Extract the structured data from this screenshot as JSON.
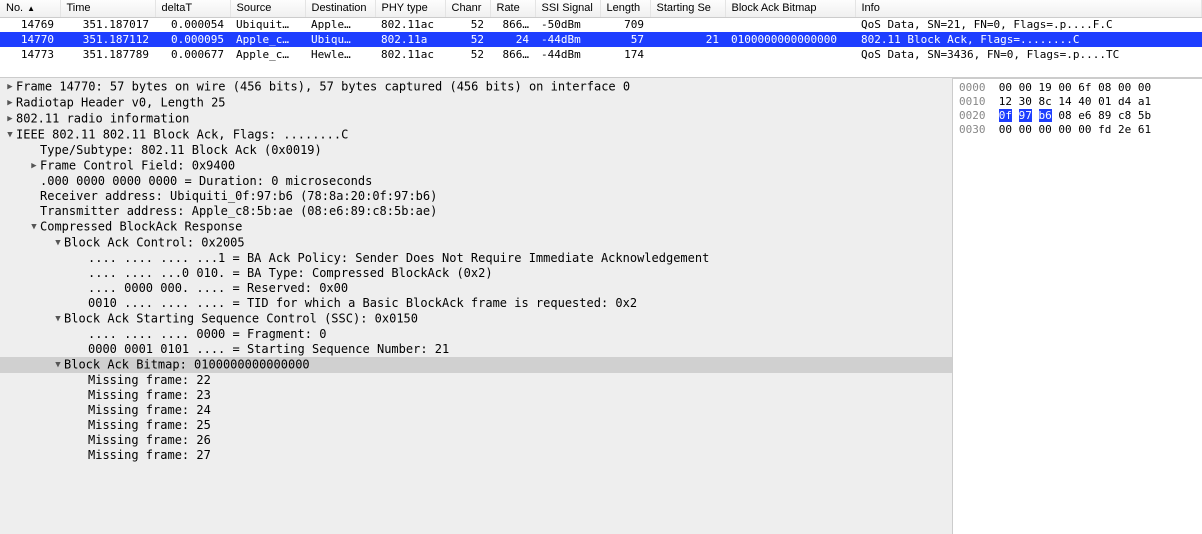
{
  "packet_list": {
    "columns": [
      "No.",
      "Time",
      "deltaT",
      "Source",
      "Destination",
      "PHY type",
      "Chanr",
      "Rate",
      "SSI Signal",
      "Length",
      "Starting Se",
      "Block Ack Bitmap",
      "Info"
    ],
    "sort_col_idx": 0,
    "rows": [
      {
        "cells": [
          "14769",
          "351.187017",
          "0.000054",
          "Ubiquit…",
          "Apple…",
          "802.11ac",
          "52",
          "866…",
          "-50dBm",
          "709",
          "",
          "",
          "QoS Data, SN=21, FN=0, Flags=.p....F.C"
        ],
        "selected": false
      },
      {
        "cells": [
          "14770",
          "351.187112",
          "0.000095",
          "Apple_c…",
          "Ubiqu…",
          "802.11a",
          "52",
          "24",
          "-44dBm",
          "57",
          "21",
          "0100000000000000",
          "802.11 Block Ack, Flags=........C"
        ],
        "selected": true
      },
      {
        "cells": [
          "14773",
          "351.187789",
          "0.000677",
          "Apple_c…",
          "Hewle…",
          "802.11ac",
          "52",
          "866…",
          "-44dBm",
          "174",
          "",
          "",
          "QoS Data, SN=3436, FN=0, Flags=.p....TC"
        ],
        "selected": false
      }
    ]
  },
  "tree": [
    {
      "depth": 0,
      "tri": "closed",
      "text": "Frame 14770: 57 bytes on wire (456 bits), 57 bytes captured (456 bits) on interface 0"
    },
    {
      "depth": 0,
      "tri": "closed",
      "text": "Radiotap Header v0, Length 25"
    },
    {
      "depth": 0,
      "tri": "closed",
      "text": "802.11 radio information"
    },
    {
      "depth": 0,
      "tri": "open",
      "text": "IEEE 802.11 802.11 Block Ack, Flags: ........C"
    },
    {
      "depth": 1,
      "tri": "",
      "text": "Type/Subtype: 802.11 Block Ack (0x0019)"
    },
    {
      "depth": 1,
      "tri": "closed",
      "text": "Frame Control Field: 0x9400"
    },
    {
      "depth": 1,
      "tri": "",
      "text": ".000 0000 0000 0000 = Duration: 0 microseconds"
    },
    {
      "depth": 1,
      "tri": "",
      "text": "Receiver address: Ubiquiti_0f:97:b6 (78:8a:20:0f:97:b6)"
    },
    {
      "depth": 1,
      "tri": "",
      "text": "Transmitter address: Apple_c8:5b:ae (08:e6:89:c8:5b:ae)"
    },
    {
      "depth": 1,
      "tri": "open",
      "text": "Compressed BlockAck Response"
    },
    {
      "depth": 2,
      "tri": "open",
      "text": "Block Ack Control: 0x2005"
    },
    {
      "depth": 3,
      "tri": "",
      "text": ".... .... .... ...1 = BA Ack Policy: Sender Does Not Require Immediate Acknowledgement"
    },
    {
      "depth": 3,
      "tri": "",
      "text": ".... .... ...0 010. = BA Type: Compressed BlockAck (0x2)"
    },
    {
      "depth": 3,
      "tri": "",
      "text": ".... 0000 000. .... = Reserved: 0x00"
    },
    {
      "depth": 3,
      "tri": "",
      "text": "0010 .... .... .... = TID for which a Basic BlockAck frame is requested: 0x2"
    },
    {
      "depth": 2,
      "tri": "open",
      "text": "Block Ack Starting Sequence Control (SSC): 0x0150"
    },
    {
      "depth": 3,
      "tri": "",
      "text": ".... .... .... 0000 = Fragment: 0"
    },
    {
      "depth": 3,
      "tri": "",
      "text": "0000 0001 0101 .... = Starting Sequence Number: 21"
    },
    {
      "depth": 2,
      "tri": "open",
      "text": "Block Ack Bitmap: 0100000000000000",
      "highlight": true
    },
    {
      "depth": 3,
      "tri": "",
      "text": "Missing frame: 22"
    },
    {
      "depth": 3,
      "tri": "",
      "text": "Missing frame: 23"
    },
    {
      "depth": 3,
      "tri": "",
      "text": "Missing frame: 24"
    },
    {
      "depth": 3,
      "tri": "",
      "text": "Missing frame: 25"
    },
    {
      "depth": 3,
      "tri": "",
      "text": "Missing frame: 26"
    },
    {
      "depth": 3,
      "tri": "",
      "text": "Missing frame: 27"
    }
  ],
  "hex": {
    "rows": [
      {
        "offset": "0000",
        "bytes": [
          "00",
          "00",
          "19",
          "00",
          "6f",
          "08",
          "00",
          "00"
        ]
      },
      {
        "offset": "0010",
        "bytes": [
          "12",
          "30",
          "8c",
          "14",
          "40",
          "01",
          "d4",
          "a1"
        ]
      },
      {
        "offset": "0020",
        "bytes": [
          "0f",
          "97",
          "b6",
          "08",
          "e6",
          "89",
          "c8",
          "5b"
        ],
        "sel": [
          0,
          1,
          2
        ]
      },
      {
        "offset": "0030",
        "bytes": [
          "00",
          "00",
          "00",
          "00",
          "00",
          "fd",
          "2e",
          "61"
        ]
      }
    ]
  }
}
